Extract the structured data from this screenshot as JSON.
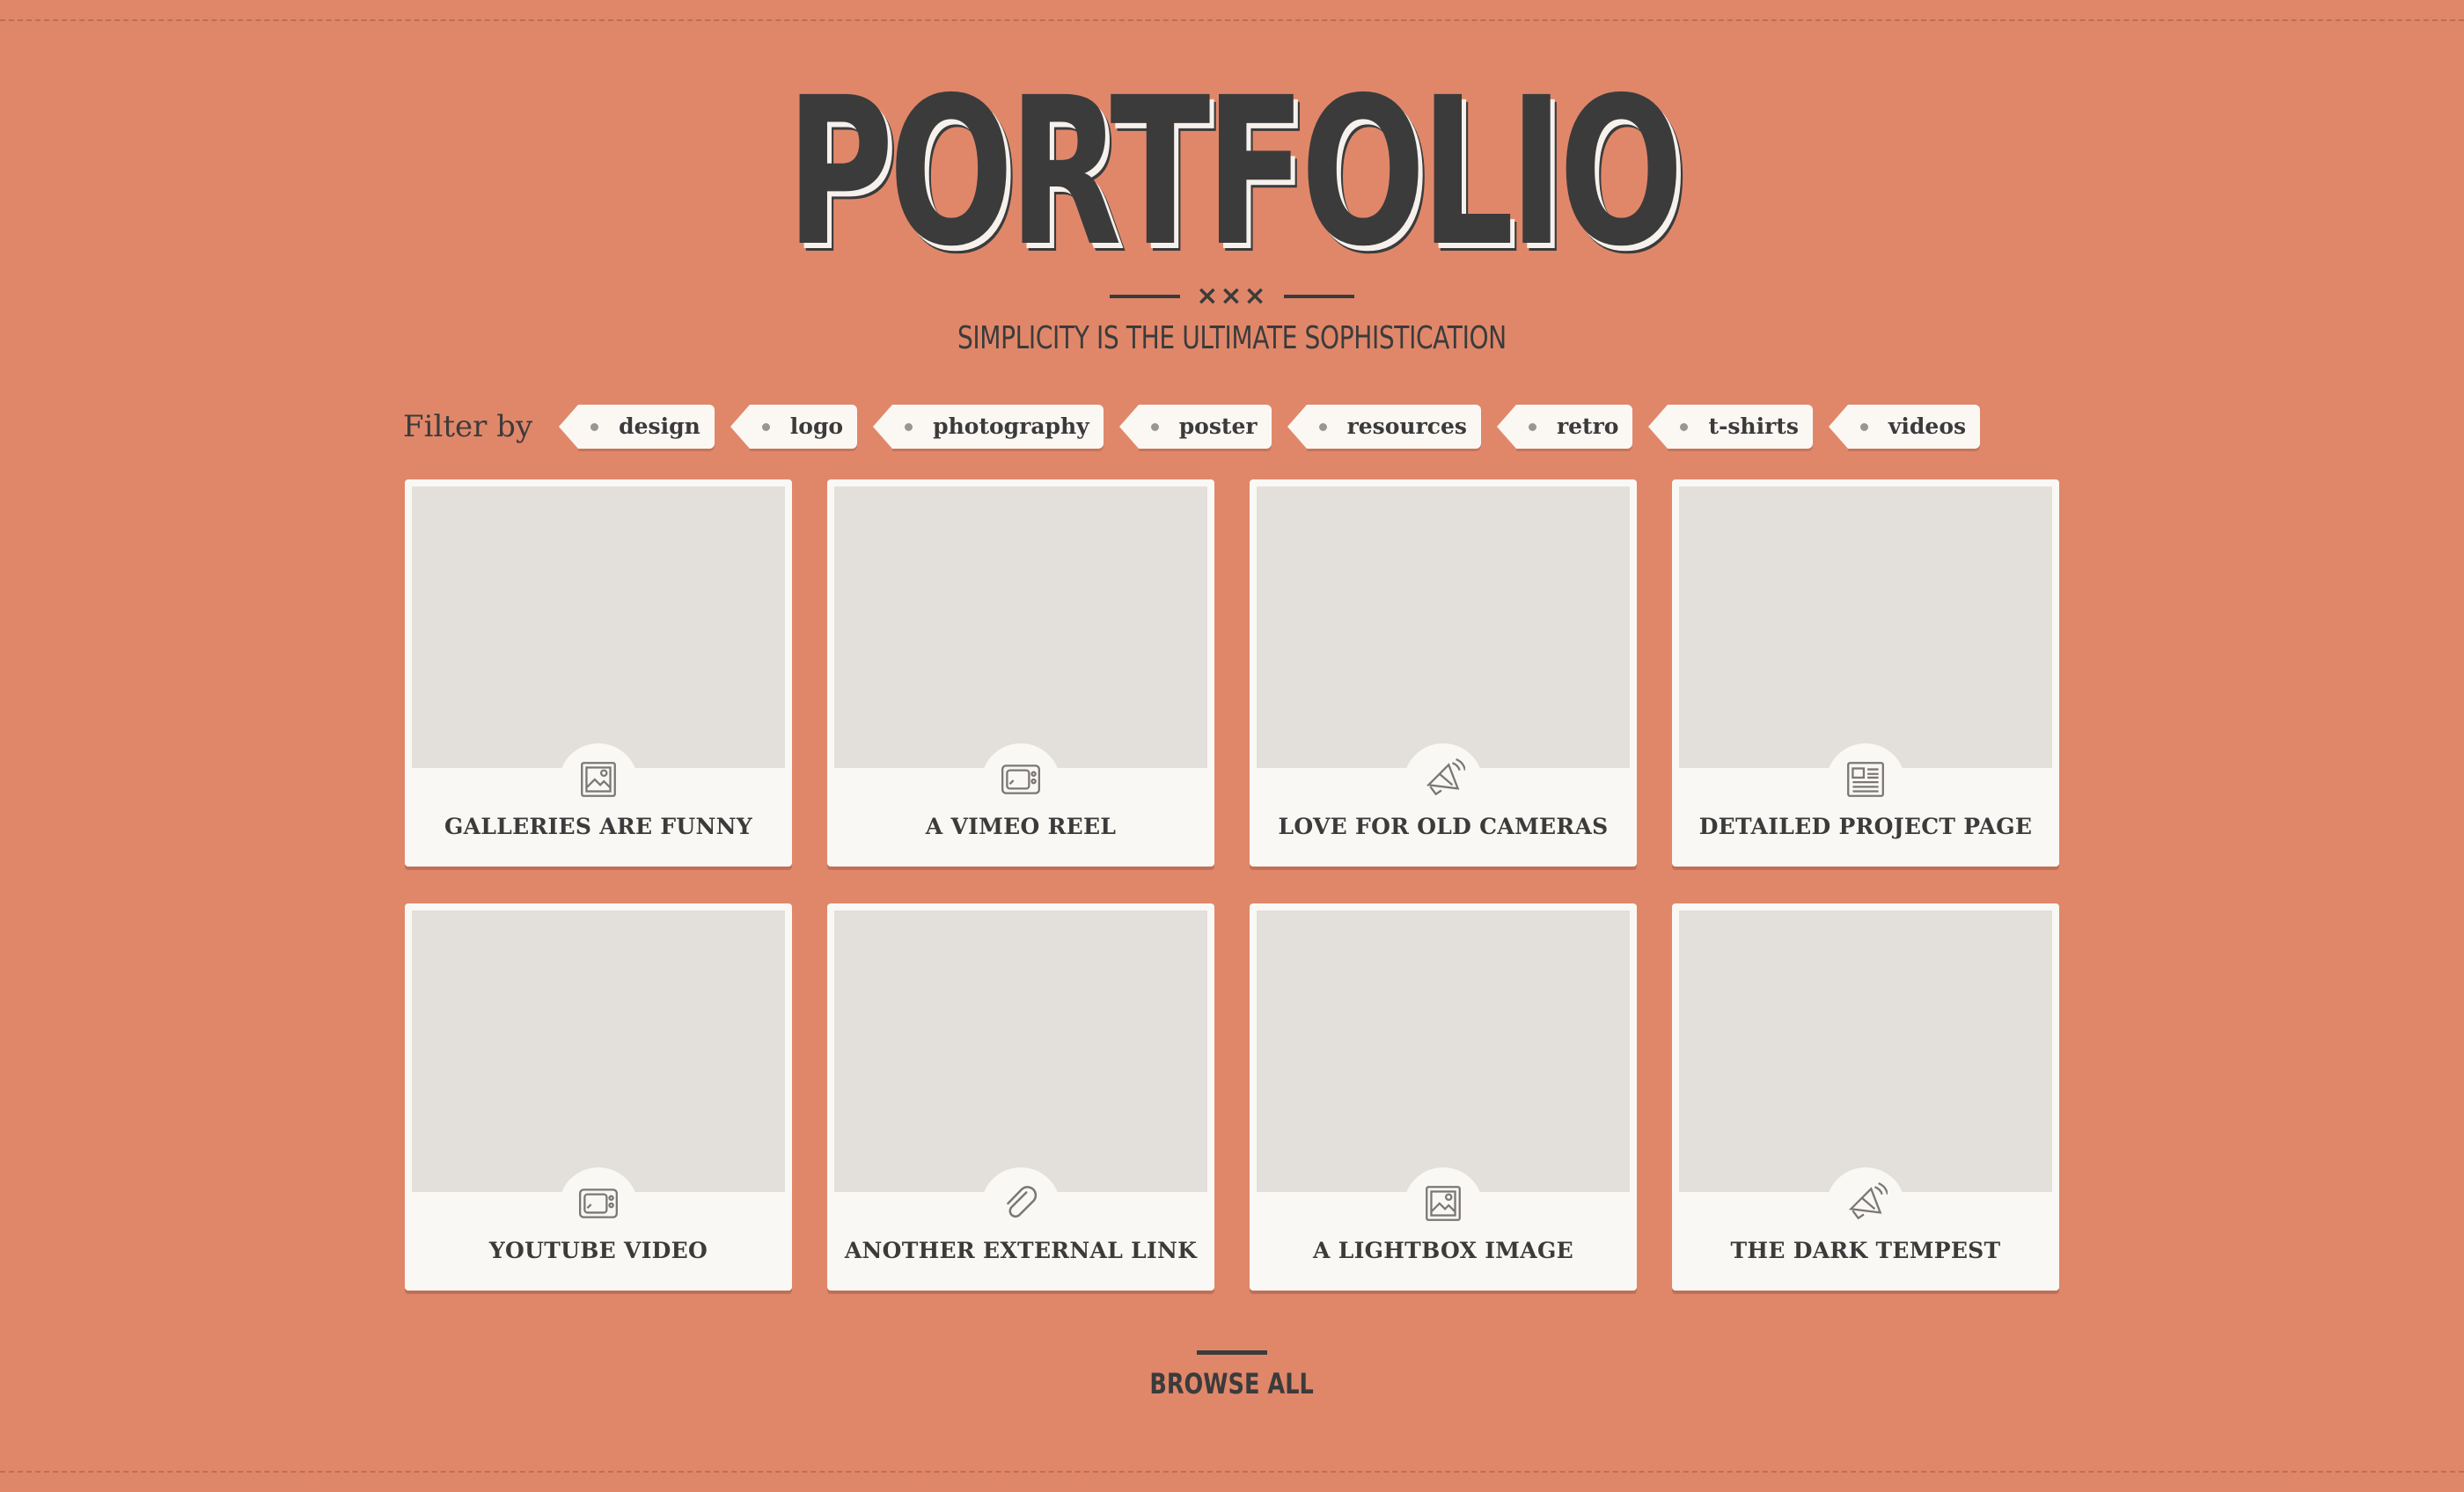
{
  "header": {
    "title": "PORTFOLIO",
    "ornament": "×××",
    "tagline": "SIMPLICITY IS THE ULTIMATE SOPHISTICATION"
  },
  "filter": {
    "label": "Filter by",
    "tags": [
      "design",
      "logo",
      "photography",
      "poster",
      "resources",
      "retro",
      "t-shirts",
      "videos"
    ]
  },
  "items": [
    {
      "title": "GALLERIES ARE FUNNY",
      "icon": "image-icon"
    },
    {
      "title": "A VIMEO REEL",
      "icon": "tv-icon"
    },
    {
      "title": "LOVE FOR OLD CAMERAS",
      "icon": "megaphone-icon"
    },
    {
      "title": "DETAILED PROJECT PAGE",
      "icon": "document-icon"
    },
    {
      "title": "YOUTUBE VIDEO",
      "icon": "tv-icon"
    },
    {
      "title": "ANOTHER EXTERNAL LINK",
      "icon": "paperclip-icon"
    },
    {
      "title": "A LIGHTBOX IMAGE",
      "icon": "image-icon"
    },
    {
      "title": "THE DARK TEMPEST",
      "icon": "megaphone-icon"
    }
  ],
  "browse": {
    "label": "BROWSE ALL"
  },
  "colors": {
    "background": "#e0876a",
    "text": "#3b3b3b",
    "card": "#faf8f4",
    "thumb": "#e3dfda",
    "icon": "#7a7774"
  }
}
